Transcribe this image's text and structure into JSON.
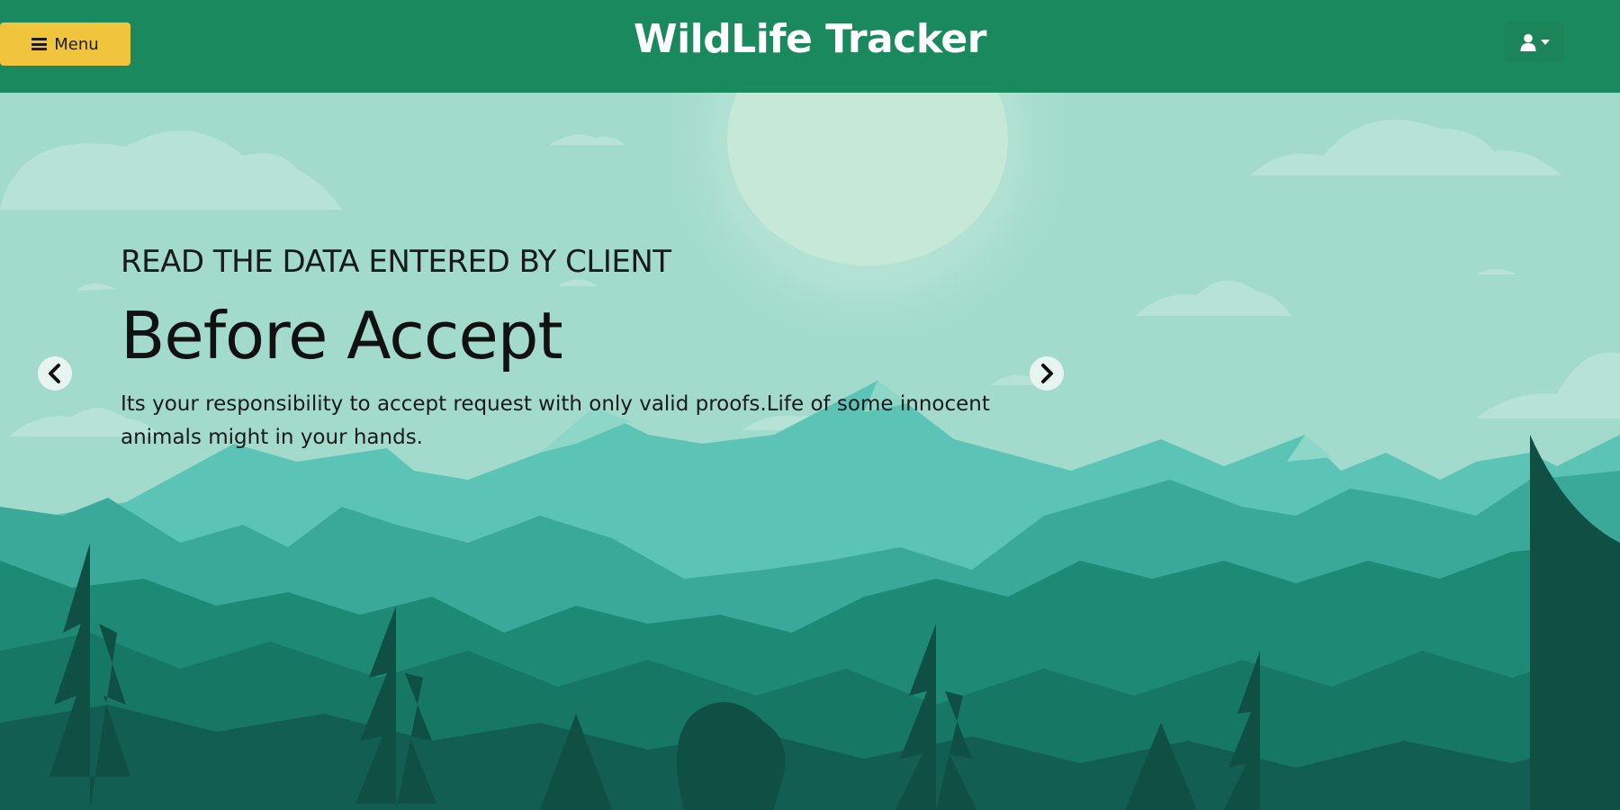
{
  "header": {
    "menu_label": "Menu",
    "brand": "WildLife Tracker",
    "user_icon": "user-icon",
    "colors": {
      "bar": "#1a8a5e",
      "menu_button": "#f0c43c"
    }
  },
  "carousel": {
    "eyebrow": "READ THE DATA ENTERED BY CLIENT",
    "title": "Before Accept",
    "description": "Its your responsibility to accept request with only valid proofs.Life of some innocent animals might in your hands.",
    "prev_icon": "chevron-left-icon",
    "next_icon": "chevron-right-icon"
  }
}
